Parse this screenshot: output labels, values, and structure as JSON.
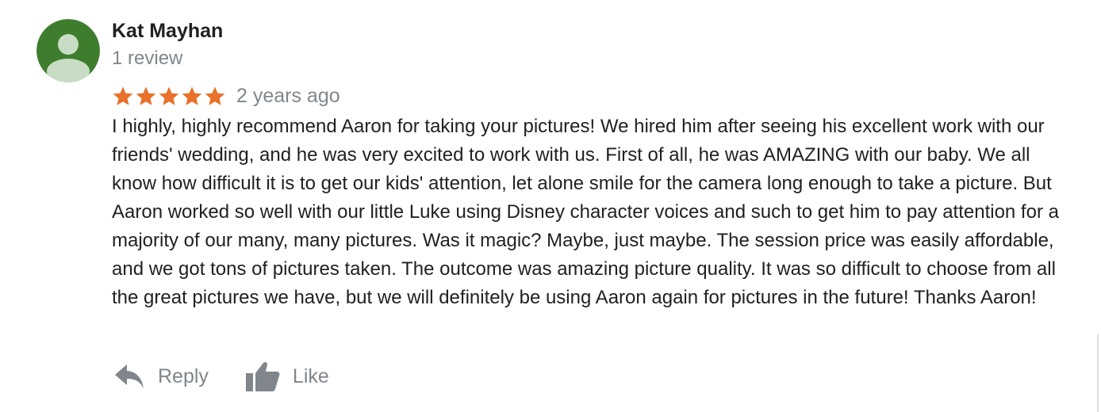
{
  "colors": {
    "avatar_bg": "#3f7d2e",
    "avatar_figure": "#c9dcc4",
    "star": "#e8712b",
    "secondary_text": "#80868b",
    "primary_text": "#202124"
  },
  "review": {
    "author": {
      "name": "Kat Mayhan",
      "review_count": "1 review",
      "avatar_icon": "person-avatar-icon"
    },
    "rating": 5,
    "max_rating": 5,
    "time_ago": "2 years ago",
    "text": "I highly, highly recommend Aaron for taking your pictures! We hired him after seeing his excellent work with our friends' wedding, and he was very excited to work with us. First of all, he was AMAZING with our baby. We all know how difficult it is to get our kids' attention, let alone smile for the camera long enough to take a picture. But Aaron worked so well with our little Luke using Disney character voices and such to get him to pay attention for a majority of our many, many pictures. Was it magic? Maybe, just maybe. The session price was easily affordable, and we got tons of pictures taken. The outcome was amazing picture quality. It was so difficult to choose from all the great pictures we have, but we will definitely be using Aaron again for pictures in the future! Thanks Aaron!",
    "actions": {
      "reply": {
        "label": "Reply",
        "icon": "reply-arrow-icon"
      },
      "like": {
        "label": "Like",
        "icon": "thumbs-up-icon"
      }
    }
  }
}
